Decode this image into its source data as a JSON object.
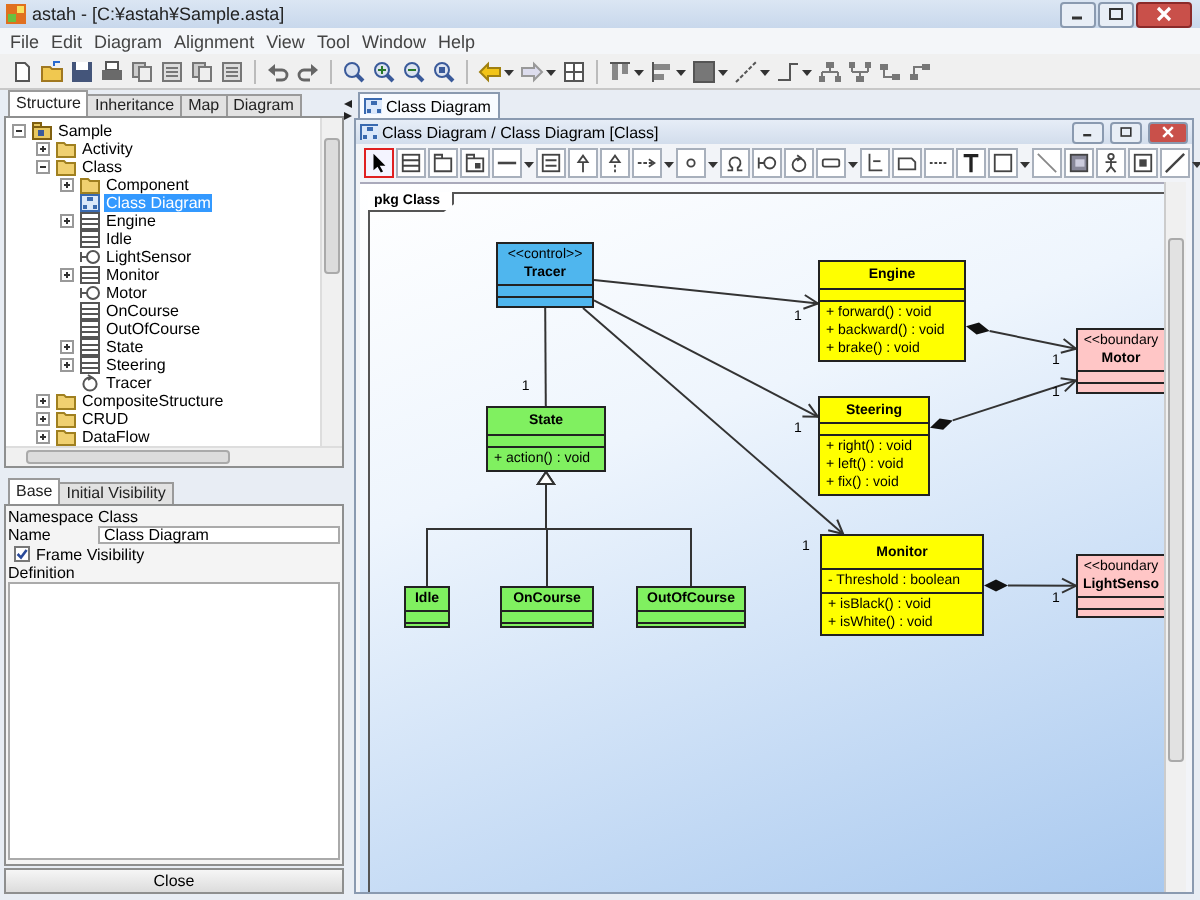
{
  "window": {
    "title": "astah - [C:¥astah¥Sample.asta]"
  },
  "menu": [
    "File",
    "Edit",
    "Diagram",
    "Alignment",
    "View",
    "Tool",
    "Window",
    "Help"
  ],
  "explorer": {
    "tabs": [
      {
        "label": "Structure",
        "selected": true
      },
      {
        "label": "Inheritance",
        "selected": false
      },
      {
        "label": "Map",
        "selected": false
      },
      {
        "label": "Diagram",
        "selected": false
      }
    ],
    "tree": [
      {
        "label": "Sample",
        "kind": "project",
        "expanded": true,
        "selected": false,
        "children": [
          {
            "label": "Activity",
            "kind": "folder",
            "expanded": false,
            "selected": false
          },
          {
            "label": "Class",
            "kind": "folder",
            "expanded": true,
            "selected": false,
            "children": [
              {
                "label": "Component",
                "kind": "folder",
                "expanded": false,
                "selected": false
              },
              {
                "label": "Class Diagram",
                "kind": "diagram",
                "selected": true
              },
              {
                "label": "Engine",
                "kind": "class",
                "expanded": false,
                "selected": false
              },
              {
                "label": "Idle",
                "kind": "class",
                "selected": false
              },
              {
                "label": "LightSensor",
                "kind": "boundary",
                "selected": false
              },
              {
                "label": "Monitor",
                "kind": "class",
                "expanded": false,
                "selected": false
              },
              {
                "label": "Motor",
                "kind": "boundary",
                "selected": false
              },
              {
                "label": "OnCourse",
                "kind": "class",
                "selected": false
              },
              {
                "label": "OutOfCourse",
                "kind": "class",
                "selected": false
              },
              {
                "label": "State",
                "kind": "class",
                "expanded": false,
                "selected": false
              },
              {
                "label": "Steering",
                "kind": "class",
                "expanded": false,
                "selected": false
              },
              {
                "label": "Tracer",
                "kind": "control",
                "selected": false
              }
            ]
          },
          {
            "label": "CompositeStructure",
            "kind": "folder",
            "expanded": false,
            "selected": false
          },
          {
            "label": "CRUD",
            "kind": "folder",
            "expanded": false,
            "selected": false
          },
          {
            "label": "DataFlow",
            "kind": "folder",
            "expanded": false,
            "selected": false
          }
        ]
      }
    ]
  },
  "properties": {
    "tabs": [
      {
        "label": "Base",
        "selected": true
      },
      {
        "label": "Initial Visibility",
        "selected": false
      }
    ],
    "fields": [
      {
        "label": "Namespace",
        "kind": "text",
        "value": "Class"
      },
      {
        "label": "Name",
        "kind": "input",
        "value": "Class Diagram"
      }
    ],
    "frame_visibility": {
      "label": "Frame Visibility",
      "checked": true
    },
    "definition": {
      "label": "Definition"
    },
    "close_button": "Close"
  },
  "editor": {
    "tabs": [
      {
        "label": "Class Diagram",
        "selected": true
      }
    ],
    "window_title": "Class Diagram / Class Diagram [Class]",
    "tools": [
      {
        "kind": "pointer",
        "selected": true,
        "menu": false
      },
      {
        "kind": "class",
        "selected": false,
        "menu": false
      },
      {
        "kind": "package",
        "selected": false,
        "menu": false
      },
      {
        "kind": "subsystem",
        "selected": false,
        "menu": false
      },
      {
        "kind": "association",
        "selected": false,
        "menu": true
      },
      {
        "kind": "interface",
        "selected": false,
        "menu": false
      },
      {
        "kind": "generalization",
        "selected": false,
        "menu": false
      },
      {
        "kind": "realization",
        "selected": false,
        "menu": false
      },
      {
        "kind": "dependency",
        "selected": false,
        "menu": true
      },
      {
        "kind": "lollipop",
        "selected": false,
        "menu": true
      },
      {
        "kind": "socket",
        "selected": false,
        "menu": false
      },
      {
        "kind": "boundary",
        "selected": false,
        "menu": false
      },
      {
        "kind": "control",
        "selected": false,
        "menu": false
      },
      {
        "kind": "entity",
        "selected": false,
        "menu": true
      },
      {
        "kind": "containment",
        "selected": false,
        "menu": false
      },
      {
        "kind": "note",
        "selected": false,
        "menu": false
      },
      {
        "kind": "note_anchor",
        "selected": false,
        "menu": false
      },
      {
        "kind": "text",
        "selected": false,
        "menu": false
      },
      {
        "kind": "rectangle",
        "selected": false,
        "menu": true
      },
      {
        "kind": "line",
        "selected": false,
        "menu": false
      },
      {
        "kind": "image",
        "selected": false,
        "menu": false
      },
      {
        "kind": "actor",
        "selected": false,
        "menu": false
      },
      {
        "kind": "frame",
        "selected": false,
        "menu": false
      },
      {
        "kind": "connector",
        "selected": false,
        "menu": true
      }
    ],
    "diagram": {
      "frame_label": "pkg Class",
      "classes": [
        {
          "stereotype": "<<control>>",
          "name": "Tracer",
          "color": "#4fb6ee"
        },
        {
          "name": "Engine",
          "color": "#ffff00",
          "operations": [
            "+ forward() : void",
            "+ backward() : void",
            "+ brake() : void"
          ]
        },
        {
          "stereotype": "<<boundary",
          "name": "Motor",
          "color": "#ffc6c6"
        },
        {
          "name": "State",
          "color": "#80f060",
          "operations": [
            "+ action() : void"
          ]
        },
        {
          "name": "Steering",
          "color": "#ffff00",
          "operations": [
            "+ right() : void",
            "+ left() : void",
            "+ fix() : void"
          ]
        },
        {
          "name": "Monitor",
          "color": "#ffff00",
          "attributes": [
            "- Threshold : boolean"
          ],
          "operations": [
            "+ isBlack() : void",
            "+ isWhite() : void"
          ]
        },
        {
          "stereotype": "<<boundary",
          "name": "LightSenso",
          "color": "#ffc6c6"
        },
        {
          "name": "Idle",
          "color": "#80f060"
        },
        {
          "name": "OnCourse",
          "color": "#80f060"
        },
        {
          "name": "OutOfCourse",
          "color": "#80f060"
        }
      ],
      "relations": [
        {
          "kind": "directed_association",
          "multiplicity": "1"
        },
        {
          "kind": "directed_association",
          "multiplicity": "1"
        },
        {
          "kind": "directed_association",
          "multiplicity": "1"
        },
        {
          "kind": "association",
          "multiplicity": "1"
        },
        {
          "kind": "composition",
          "multiplicity": "1"
        },
        {
          "kind": "composition",
          "multiplicity": "1"
        },
        {
          "kind": "composition",
          "multiplicity": "1"
        },
        {
          "kind": "generalization"
        },
        {
          "kind": "generalization"
        },
        {
          "kind": "generalization"
        }
      ]
    }
  }
}
